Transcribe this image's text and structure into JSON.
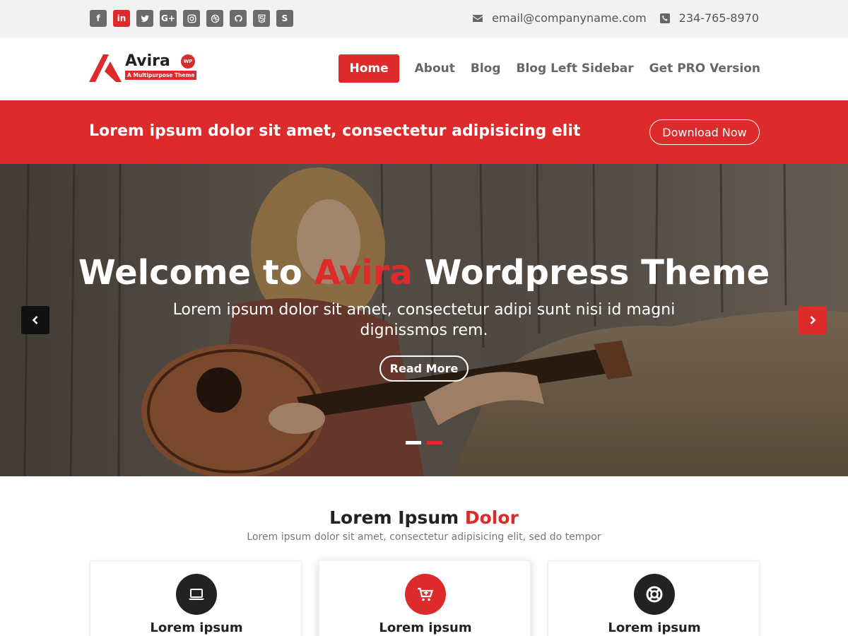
{
  "topbar": {
    "social_icons": [
      "facebook-icon",
      "linkedin-icon",
      "twitter-icon",
      "google-plus-icon",
      "instagram-icon",
      "dribbble-icon",
      "github-icon",
      "html5-icon",
      "skype-icon"
    ],
    "social_glyphs": [
      "f",
      "in",
      "",
      "G+",
      "",
      "",
      "",
      "",
      "S"
    ],
    "email": "email@companyname.com",
    "phone": "234-765-8970"
  },
  "header": {
    "logo_title": "Avira",
    "logo_badge": "WP",
    "logo_tagline": "A Multipurpose Theme",
    "nav": [
      "Home",
      "About",
      "Blog",
      "Blog Left Sidebar",
      "Get PRO Version"
    ]
  },
  "banner": {
    "text": "Lorem ipsum dolor sit amet, consectetur adipisicing elit",
    "button": "Download Now"
  },
  "hero": {
    "title_before": "Welcome to ",
    "title_accent": "Avira",
    "title_after": " Wordpress Theme",
    "subtitle": "Lorem ipsum dolor sit amet, consectetur adipi sunt nisi id magni dignissmos rem.",
    "button": "Read More",
    "active_slide": 2,
    "slide_count": 2
  },
  "services": {
    "title_before": "Lorem Ipsum ",
    "title_accent": "Dolor",
    "subtitle": "Lorem ipsum dolor sit amet, consectetur adipisicing elit, sed do tempor",
    "cards": [
      {
        "icon": "laptop-icon",
        "title": "Lorem ipsum"
      },
      {
        "icon": "cart-icon",
        "title": "Lorem ipsum"
      },
      {
        "icon": "life-ring-icon",
        "title": "Lorem ipsum"
      }
    ]
  },
  "colors": {
    "accent": "#dd2b2b",
    "dark": "#222222",
    "topbar_bg": "#f2f2f2",
    "icon_gray": "#6b6b6b"
  }
}
